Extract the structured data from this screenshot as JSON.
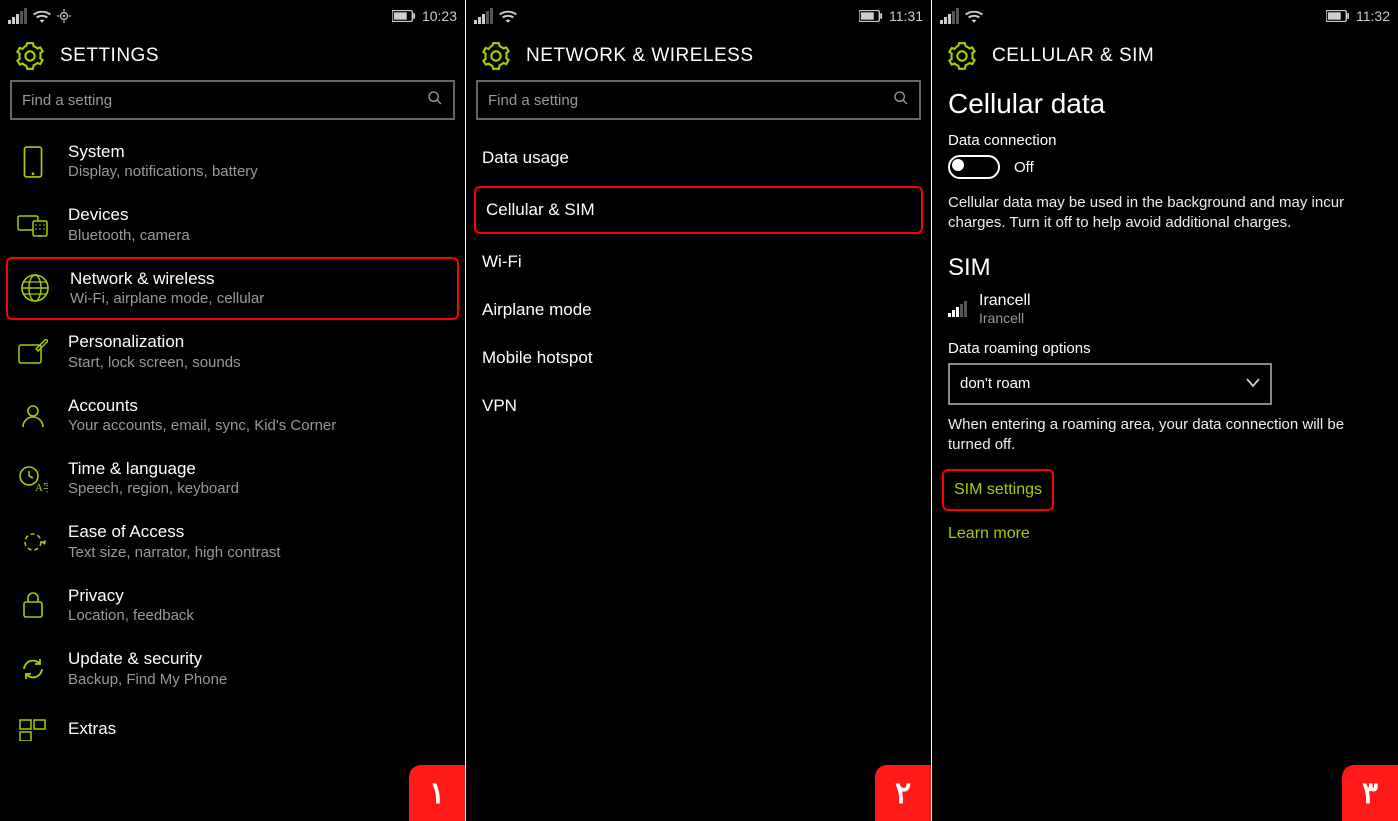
{
  "colors": {
    "accent": "#a4cf00",
    "highlight": "#ff0000",
    "badge_bg": "#ff1a1a"
  },
  "screens": [
    {
      "status": {
        "time": "10:23",
        "has_location": true
      },
      "title": "SETTINGS",
      "search_placeholder": "Find a setting",
      "items": [
        {
          "icon": "phone-icon",
          "title": "System",
          "sub": "Display, notifications, battery"
        },
        {
          "icon": "devices-icon",
          "title": "Devices",
          "sub": "Bluetooth, camera"
        },
        {
          "icon": "globe-icon",
          "title": "Network & wireless",
          "sub": "Wi-Fi, airplane mode, cellular",
          "highlighted": true
        },
        {
          "icon": "personalization-icon",
          "title": "Personalization",
          "sub": "Start, lock screen, sounds"
        },
        {
          "icon": "accounts-icon",
          "title": "Accounts",
          "sub": "Your accounts, email, sync, Kid's Corner"
        },
        {
          "icon": "time-icon",
          "title": "Time & language",
          "sub": "Speech, region, keyboard"
        },
        {
          "icon": "ease-icon",
          "title": "Ease of Access",
          "sub": "Text size, narrator, high contrast"
        },
        {
          "icon": "privacy-icon",
          "title": "Privacy",
          "sub": "Location, feedback"
        },
        {
          "icon": "update-icon",
          "title": "Update & security",
          "sub": "Backup, Find My Phone"
        },
        {
          "icon": "extras-icon",
          "title": "Extras",
          "sub": ""
        }
      ],
      "badge": "۱"
    },
    {
      "status": {
        "time": "11:31",
        "has_location": false
      },
      "title": "NETWORK & WIRELESS",
      "search_placeholder": "Find a setting",
      "items": [
        {
          "title": "Data usage"
        },
        {
          "title": "Cellular & SIM",
          "highlighted": true
        },
        {
          "title": "Wi-Fi"
        },
        {
          "title": "Airplane mode"
        },
        {
          "title": "Mobile hotspot"
        },
        {
          "title": "VPN"
        }
      ],
      "badge": "۲"
    },
    {
      "status": {
        "time": "11:32",
        "has_location": false
      },
      "title": "CELLULAR & SIM",
      "section1_title": "Cellular data",
      "data_conn_label": "Data connection",
      "toggle_label": "Off",
      "desc1": "Cellular data may be used in the background and may incur charges. Turn it off to help avoid additional charges.",
      "section2_title": "SIM",
      "sim": {
        "name": "Irancell",
        "sub": "Irancell"
      },
      "roaming_label": "Data roaming options",
      "roaming_value": "don't roam",
      "desc2": "When entering a roaming area, your data connection will be turned off.",
      "sim_settings": "SIM settings",
      "learn_more": "Learn more",
      "badge": "۳"
    }
  ]
}
